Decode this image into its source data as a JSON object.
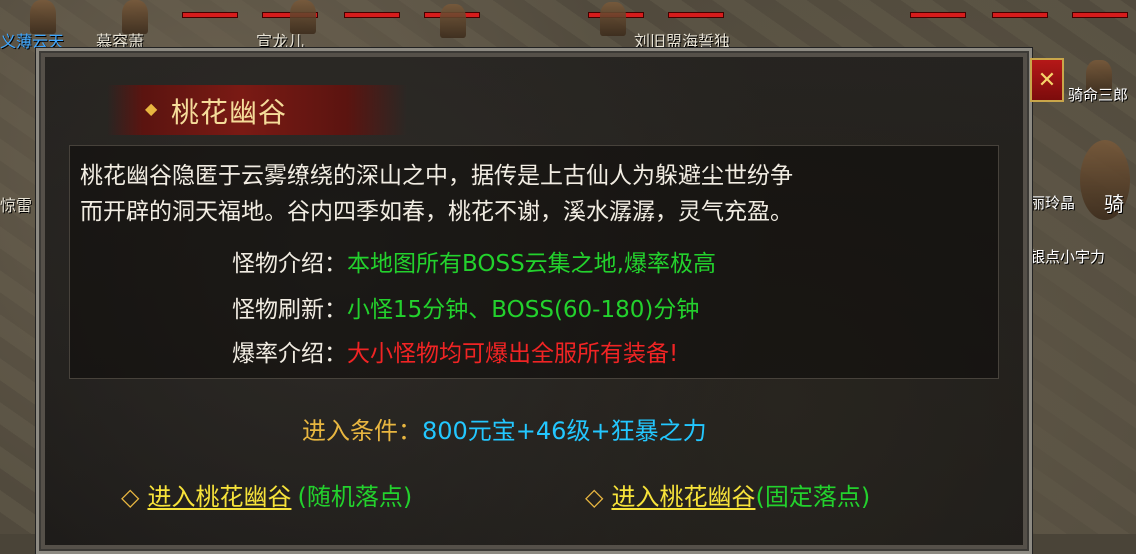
{
  "scene": {
    "player_names": [
      "义薄云天",
      "慕容萧",
      "宣龙儿",
      "刘旧盟海誓独",
      "骑命三郎",
      "丽玲晶",
      "骑",
      "银点小宇力",
      "惊雷"
    ]
  },
  "dialog": {
    "title": "桃花幽谷",
    "description": [
      "桃花幽谷隐匿于云雾缭绕的深山之中，据传是上古仙人为躲避尘世纷争",
      "而开辟的洞天福地。谷内四季如春，桃花不谢，溪水潺潺，灵气充盈。"
    ],
    "info": [
      {
        "label": "怪物介绍：",
        "value": "本地图所有BOSS云集之地,爆率极高",
        "color": "#23d12d"
      },
      {
        "label": "怪物刷新：",
        "value": "小怪15分钟、BOSS(60-180)分钟",
        "color": "#23d12d"
      },
      {
        "label": "爆率介绍：",
        "value": "大小怪物均可爆出全服所有装备!",
        "color": "#f02424"
      }
    ],
    "condition": {
      "label": "进入条件：",
      "value": "800元宝+46级+狂暴之力"
    },
    "links": [
      {
        "text": "进入桃花幽谷",
        "note": "(随机落点)"
      },
      {
        "text": "进入桃花幽谷",
        "note": "(固定落点)"
      }
    ],
    "close_label": "✕"
  }
}
